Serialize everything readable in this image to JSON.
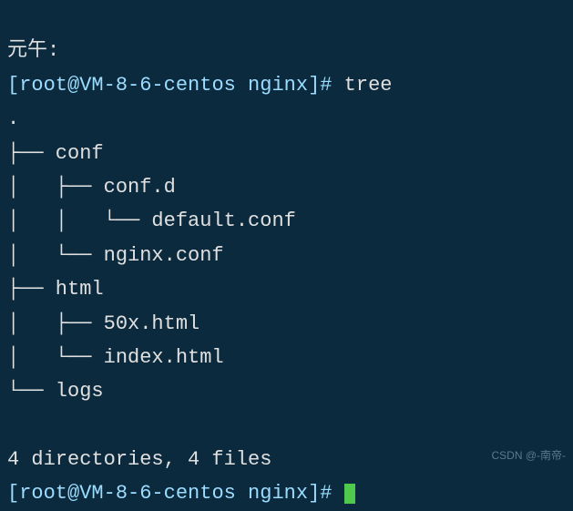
{
  "partial_top": "元午:",
  "prompt1": {
    "open": "[",
    "userhost": "root@VM-8-6-centos",
    "space": " ",
    "dir": "nginx",
    "close": "]#",
    "command": "tree"
  },
  "tree": {
    "root": ".",
    "l1": "├── conf",
    "l2": "│   ├── conf.d",
    "l3": "│   │   └── default.conf",
    "l4": "│   └── nginx.conf",
    "l5": "├── html",
    "l6": "│   ├── 50x.html",
    "l7": "│   └── index.html",
    "l8": "└── logs"
  },
  "summary": "4 directories, 4 files",
  "prompt2": {
    "open": "[",
    "userhost": "root@VM-8-6-centos",
    "space": " ",
    "dir": "nginx",
    "close": "]#"
  },
  "watermark": "CSDN @-南帝-"
}
